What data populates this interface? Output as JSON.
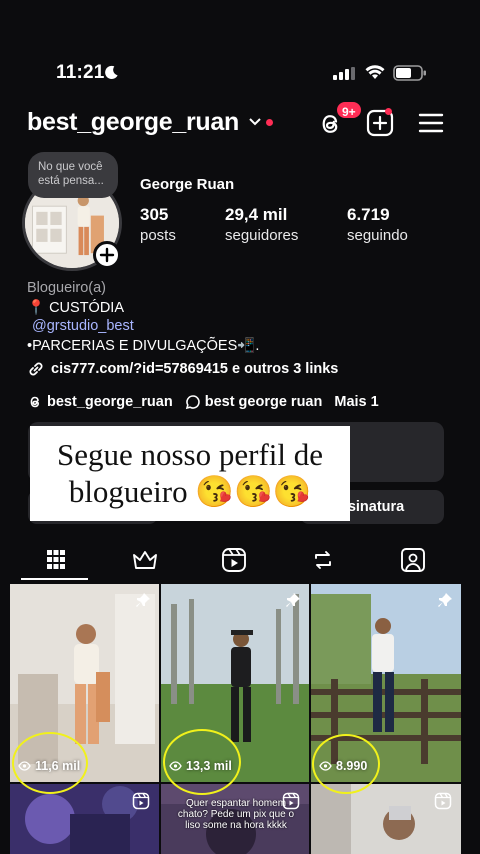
{
  "status_bar": {
    "time": "11:21"
  },
  "header": {
    "username": "best_george_ruan",
    "notification_badge": "9+"
  },
  "profile": {
    "note": [
      "No que você",
      "está pensa..."
    ],
    "display_name": "George Ruan",
    "stats": [
      {
        "value": "305",
        "label": "posts"
      },
      {
        "value": "29,4 mil",
        "label": "seguidores"
      },
      {
        "value": "6.719",
        "label": "seguindo"
      }
    ],
    "bio": {
      "category": "Blogueiro(a)",
      "line1": "📍 CUSTÓDIA",
      "mention": "@grstudio_best",
      "line3": "•PARCERIAS E DIVULGAÇÕES📲.",
      "link": "cis777.com/?id=57869415 e outros 3 links"
    },
    "social_links": [
      "best_george_ruan",
      "best george ruan",
      "Mais 1"
    ],
    "subscription_button": "ssinatura"
  },
  "overlay": {
    "line1": "Segue nosso perfil de",
    "line2": "blogueiro 😘😘😘"
  },
  "tabs": [
    "grid",
    "crown",
    "reels",
    "reposts",
    "tagged"
  ],
  "grid": {
    "row1": [
      {
        "views": "11,6 mil",
        "pinned": true
      },
      {
        "views": "13,3 mil",
        "pinned": true
      },
      {
        "views": "8.990",
        "pinned": true
      }
    ],
    "row2_caption": [
      "Quer espantar homem",
      "chato? Pede um pix que o",
      "liso some na hora kkkk"
    ]
  },
  "colors": {
    "background": "#0c0c0e",
    "badge": "#ff2d55",
    "mention": "#a9b6ff",
    "highlight": "#f1f11b"
  }
}
